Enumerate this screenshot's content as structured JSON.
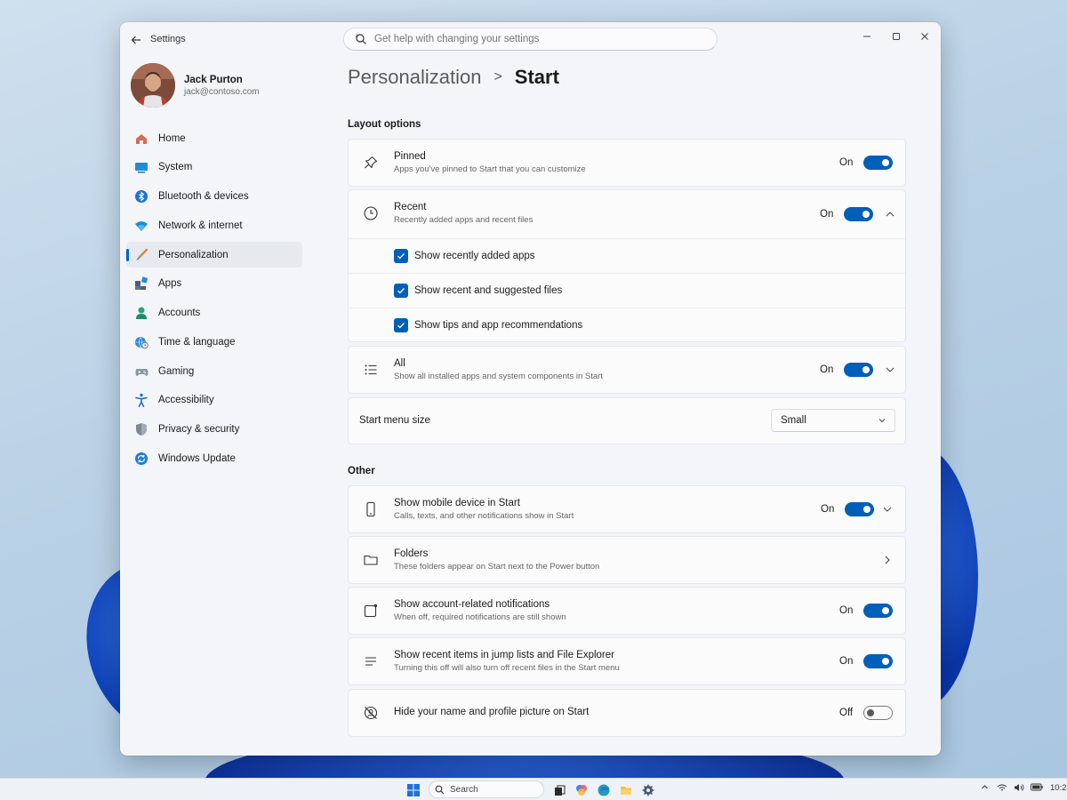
{
  "window": {
    "app_title": "Settings",
    "search_placeholder": "Get help with changing your settings"
  },
  "profile": {
    "name": "Jack Purton",
    "email": "jack@contoso.com"
  },
  "nav": [
    {
      "label": "Home",
      "icon": "home-icon"
    },
    {
      "label": "System",
      "icon": "system-icon"
    },
    {
      "label": "Bluetooth & devices",
      "icon": "bluetooth-icon"
    },
    {
      "label": "Network & internet",
      "icon": "wifi-icon"
    },
    {
      "label": "Personalization",
      "icon": "brush-icon",
      "active": true
    },
    {
      "label": "Apps",
      "icon": "apps-icon"
    },
    {
      "label": "Accounts",
      "icon": "person-icon"
    },
    {
      "label": "Time & language",
      "icon": "globe-clock-icon"
    },
    {
      "label": "Gaming",
      "icon": "controller-icon"
    },
    {
      "label": "Accessibility",
      "icon": "accessibility-icon"
    },
    {
      "label": "Privacy & security",
      "icon": "shield-icon"
    },
    {
      "label": "Windows Update",
      "icon": "update-icon"
    }
  ],
  "breadcrumb": {
    "parent": "Personalization",
    "separator": ">",
    "current": "Start"
  },
  "layout_options": {
    "title": "Layout options",
    "pinned": {
      "title": "Pinned",
      "desc": "Apps you've pinned to Start that you can customize",
      "state": "On"
    },
    "recent": {
      "title": "Recent",
      "desc": "Recently added apps and recent files",
      "state": "On",
      "options": [
        {
          "label": "Show recently added apps",
          "checked": true
        },
        {
          "label": "Show recent and suggested files",
          "checked": true
        },
        {
          "label": "Show tips and app recommendations",
          "checked": true
        }
      ]
    },
    "all": {
      "title": "All",
      "desc": "Show all installed apps and system components in Start",
      "state": "On"
    },
    "menu_size": {
      "label": "Start menu size",
      "value": "Small"
    }
  },
  "other": {
    "title": "Other",
    "mobile": {
      "title": "Show mobile device in Start",
      "desc": "Calls, texts, and other notifications show in Start",
      "state": "On"
    },
    "folders": {
      "title": "Folders",
      "desc": "These folders appear on Start next to the Power button"
    },
    "account_notifications": {
      "title": "Show account-related notifications",
      "desc": "When off, required notifications are still shown",
      "state": "On"
    },
    "jump_lists": {
      "title": "Show recent items in jump lists and File Explorer",
      "desc": "Turning this off will also turn off recent files in the Start menu",
      "state": "On"
    },
    "hide_name": {
      "title": "Hide your name and profile picture on Start",
      "state": "Off"
    }
  },
  "taskbar": {
    "search_label": "Search",
    "clock": "10:2"
  },
  "colors": {
    "accent": "#005fb8",
    "window_bg": "#f3f5f9",
    "card_bg": "#fbfbfc"
  }
}
